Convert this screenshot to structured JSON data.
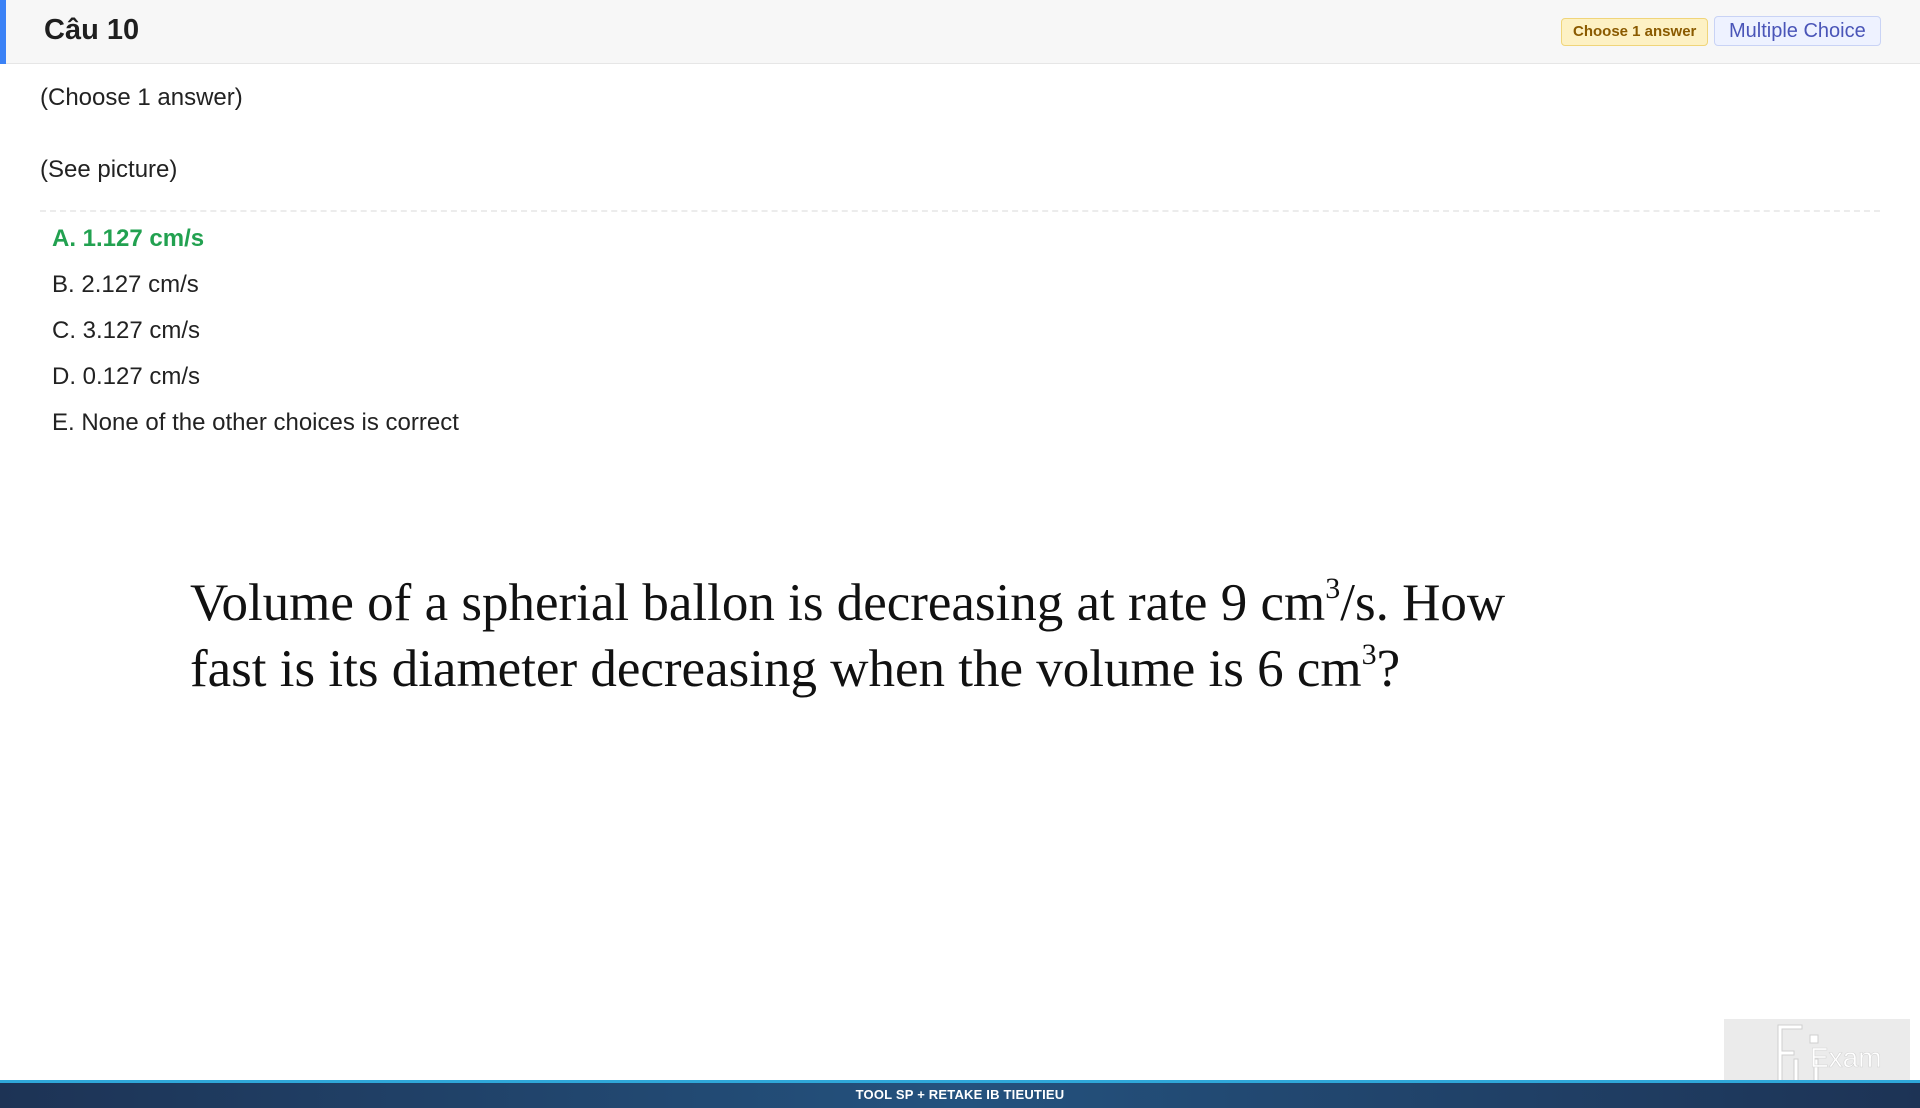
{
  "header": {
    "title": "Câu 10",
    "badge_choose": "Choose 1 answer",
    "badge_type": "Multiple Choice",
    "accent_color": "#3b82f6"
  },
  "question": {
    "instruction": "(Choose 1 answer)",
    "see_picture": "(See picture)",
    "image_text": {
      "line1_before_sup": "Volume of a spherial ballon is decreasing at rate 9 cm",
      "line1_sup": "3",
      "line1_after_sup": "/s. How",
      "line2_before_sup": "fast is its diameter decreasing when the volume is 6 cm",
      "line2_sup": "3",
      "line2_after_sup": "?"
    }
  },
  "options": [
    {
      "label": "A. 1.127 cm/s",
      "correct": true
    },
    {
      "label": "B. 2.127 cm/s",
      "correct": false
    },
    {
      "label": "C. 3.127 cm/s",
      "correct": false
    },
    {
      "label": "D. 0.127 cm/s",
      "correct": false
    },
    {
      "label": "E. None of the other choices is correct",
      "correct": false
    }
  ],
  "correct_color": "#22a150",
  "logo": {
    "text": "Exam",
    "icon": "fu-exam-logo-icon"
  },
  "footer": {
    "text": "TOOL SP + RETAKE IB TIEUTIEU"
  }
}
